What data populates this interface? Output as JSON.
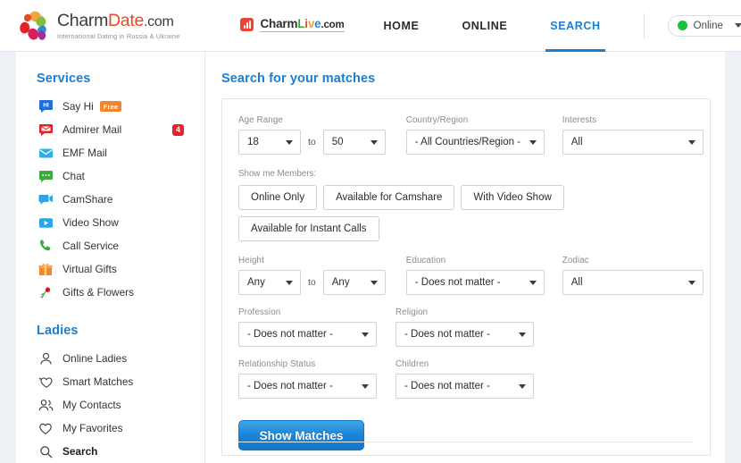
{
  "header": {
    "brand": {
      "name_part1": "Charm",
      "name_part2": "Date",
      "name_part3": ".com",
      "tagline": "International Dating in Russia & Ukraine",
      "icon": "charmdate-petals-logo"
    },
    "charmlive": {
      "icon": "charmlive-bars-icon",
      "letters": [
        "C",
        "h",
        "a",
        "r",
        "m",
        "L",
        "i",
        "v",
        "e"
      ],
      "domain": ".com",
      "label": "CharmLive.com"
    },
    "nav": [
      {
        "label": "HOME",
        "active": false
      },
      {
        "label": "ONLINE",
        "active": false
      },
      {
        "label": "SEARCH",
        "active": true
      }
    ],
    "status": {
      "label": "Online",
      "dot_color": "#18c437",
      "caret": "chevron-down-icon"
    }
  },
  "sidebar": {
    "services_heading": "Services",
    "services": [
      {
        "label": "Say Hi",
        "icon": "say-hi-icon",
        "badge": "Free",
        "badge_type": "free"
      },
      {
        "label": "Admirer Mail",
        "icon": "admirer-mail-icon",
        "badge": "4",
        "badge_type": "count"
      },
      {
        "label": "EMF Mail",
        "icon": "emf-mail-icon",
        "badge": null,
        "badge_type": null
      },
      {
        "label": "Chat",
        "icon": "chat-icon",
        "badge": null,
        "badge_type": null
      },
      {
        "label": "CamShare",
        "icon": "camshare-icon",
        "badge": null,
        "badge_type": null
      },
      {
        "label": "Video Show",
        "icon": "video-show-icon",
        "badge": null,
        "badge_type": null
      },
      {
        "label": "Call Service",
        "icon": "call-service-icon",
        "badge": null,
        "badge_type": null
      },
      {
        "label": "Virtual Gifts",
        "icon": "virtual-gifts-icon",
        "badge": null,
        "badge_type": null
      },
      {
        "label": "Gifts & Flowers",
        "icon": "flowers-icon",
        "badge": null,
        "badge_type": null
      }
    ],
    "ladies_heading": "Ladies",
    "ladies": [
      {
        "label": "Online Ladies",
        "icon": "person-icon",
        "active": false
      },
      {
        "label": "Smart Matches",
        "icon": "heart-sparkle-icon",
        "active": false
      },
      {
        "label": "My Contacts",
        "icon": "people-icon",
        "active": false
      },
      {
        "label": "My Favorites",
        "icon": "heart-icon",
        "active": false
      },
      {
        "label": "Search",
        "icon": "search-icon",
        "active": true
      }
    ]
  },
  "main": {
    "title": "Search for your matches",
    "age_range": {
      "label": "Age Range",
      "from": "18",
      "to_text": "to",
      "to": "50"
    },
    "country": {
      "label": "Country/Region",
      "value": "- All Countries/Region -"
    },
    "interests": {
      "label": "Interests",
      "value": "All"
    },
    "members": {
      "label": "Show me Members:",
      "options": [
        "Online Only",
        "Available for Camshare",
        "With Video Show",
        "Available for Instant Calls"
      ]
    },
    "height": {
      "label": "Height",
      "from": "Any",
      "to_text": "to",
      "to": "Any"
    },
    "education": {
      "label": "Education",
      "value": "- Does not matter -"
    },
    "zodiac": {
      "label": "Zodiac",
      "value": "All"
    },
    "profession": {
      "label": "Profession",
      "value": "- Does not matter -"
    },
    "religion": {
      "label": "Religion",
      "value": "- Does not matter -"
    },
    "relationship": {
      "label": "Relationship Status",
      "value": "- Does not matter -"
    },
    "children": {
      "label": "Children",
      "value": "- Does not matter -"
    },
    "submit": {
      "label": "Show Matches"
    }
  }
}
